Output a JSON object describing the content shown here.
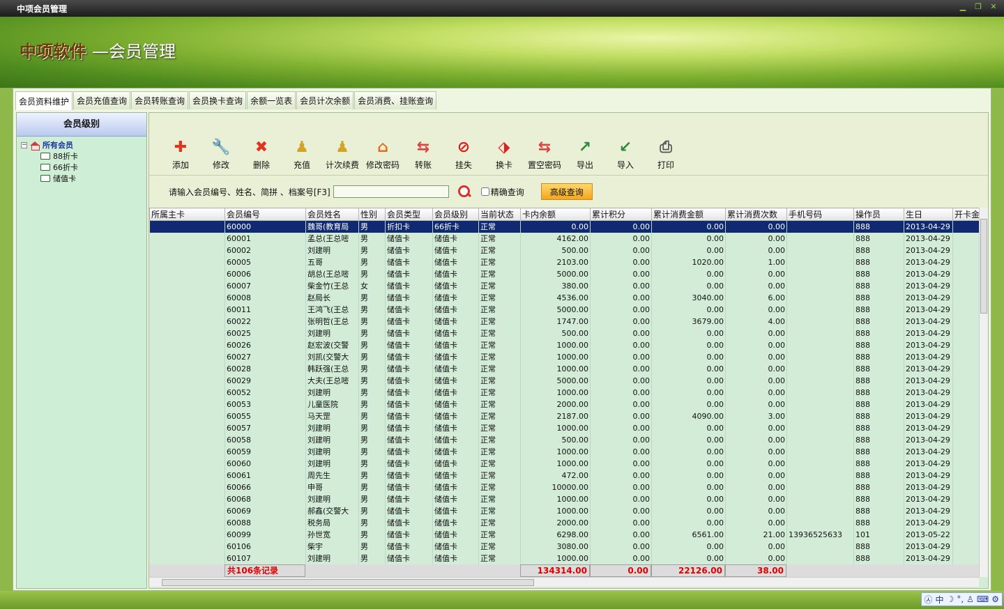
{
  "window": {
    "title": "中项会员管理"
  },
  "banner": {
    "brand": "中项软件",
    "subtitle": "—会员管理"
  },
  "tabs": [
    "会员资料维护",
    "会员充值查询",
    "会员转账查询",
    "会员换卡查询",
    "余额一览表",
    "会员计次余额",
    "会员消费、挂账查询"
  ],
  "left": {
    "title": "会员级别",
    "root": "所有会员",
    "children": [
      "88折卡",
      "66折卡",
      "储值卡"
    ]
  },
  "toolbar": [
    {
      "label": "添加",
      "icon": "plus-icon",
      "color": "#e0341e"
    },
    {
      "label": "修改",
      "icon": "wrench-icon",
      "color": "#c03030"
    },
    {
      "label": "删除",
      "icon": "x-icon",
      "color": "#e0341e"
    },
    {
      "label": "充值",
      "icon": "pawn-icon",
      "color": "#d2a52a"
    },
    {
      "label": "计次续费",
      "icon": "pawn-icon",
      "color": "#d2a52a"
    },
    {
      "label": "修改密码",
      "icon": "house-key-icon",
      "color": "#e07020"
    },
    {
      "label": "转账",
      "icon": "arrows-icon",
      "color": "#e04040"
    },
    {
      "label": "挂失",
      "icon": "stop-icon",
      "color": "#e01818"
    },
    {
      "label": "换卡",
      "icon": "card-swap-icon",
      "color": "#e02020"
    },
    {
      "label": "置空密码",
      "icon": "arrows-icon",
      "color": "#e04040"
    },
    {
      "label": "导出",
      "icon": "excel-export-icon",
      "color": "#2a8a3a"
    },
    {
      "label": "导入",
      "icon": "excel-import-icon",
      "color": "#2a8a3a"
    },
    {
      "label": "打印",
      "icon": "printer-icon",
      "color": "#555555"
    }
  ],
  "search": {
    "label": "请输入会员编号、姓名、简拼 、档案号[F3]",
    "value": "",
    "exact_label": "精确查询",
    "adv_label": "高级查询"
  },
  "columns": [
    "所属主卡",
    "会员编号",
    "会员姓名",
    "性别",
    "会员类型",
    "会员级别",
    "当前状态",
    "卡内余额",
    "累计积分",
    "累计消费金额",
    "累计消费次数",
    "手机号码",
    "操作员",
    "生日",
    "开卡金"
  ],
  "rows": [
    [
      "",
      "60000",
      "魏哥(教育局",
      "男",
      "折扣卡",
      "66折卡",
      "正常",
      "0.00",
      "0.00",
      "0.00",
      "0.00",
      "",
      "888",
      "2013-04-29",
      ""
    ],
    [
      "",
      "60001",
      "孟总(王总嘧",
      "男",
      "储值卡",
      "储值卡",
      "正常",
      "4162.00",
      "0.00",
      "0.00",
      "0.00",
      "",
      "888",
      "2013-04-29",
      ""
    ],
    [
      "",
      "60002",
      "刘建明",
      "男",
      "储值卡",
      "储值卡",
      "正常",
      "500.00",
      "0.00",
      "0.00",
      "0.00",
      "",
      "888",
      "2013-04-29",
      ""
    ],
    [
      "",
      "60005",
      "五哥",
      "男",
      "储值卡",
      "储值卡",
      "正常",
      "2103.00",
      "0.00",
      "1020.00",
      "1.00",
      "",
      "888",
      "2013-04-29",
      ""
    ],
    [
      "",
      "60006",
      "胡总(王总嘧",
      "男",
      "储值卡",
      "储值卡",
      "正常",
      "5000.00",
      "0.00",
      "0.00",
      "0.00",
      "",
      "888",
      "2013-04-29",
      ""
    ],
    [
      "",
      "60007",
      "柴金竹(王总",
      "女",
      "储值卡",
      "储值卡",
      "正常",
      "380.00",
      "0.00",
      "0.00",
      "0.00",
      "",
      "888",
      "2013-04-29",
      ""
    ],
    [
      "",
      "60008",
      "赵局长",
      "男",
      "储值卡",
      "储值卡",
      "正常",
      "4536.00",
      "0.00",
      "3040.00",
      "6.00",
      "",
      "888",
      "2013-04-29",
      ""
    ],
    [
      "",
      "60011",
      "王鸿飞(王总",
      "男",
      "储值卡",
      "储值卡",
      "正常",
      "5000.00",
      "0.00",
      "0.00",
      "0.00",
      "",
      "888",
      "2013-04-29",
      ""
    ],
    [
      "",
      "60022",
      "张明哲(王总",
      "男",
      "储值卡",
      "储值卡",
      "正常",
      "1747.00",
      "0.00",
      "3679.00",
      "4.00",
      "",
      "888",
      "2013-04-29",
      ""
    ],
    [
      "",
      "60025",
      "刘建明",
      "男",
      "储值卡",
      "储值卡",
      "正常",
      "500.00",
      "0.00",
      "0.00",
      "0.00",
      "",
      "888",
      "2013-04-29",
      ""
    ],
    [
      "",
      "60026",
      "赵宏波(交警",
      "男",
      "储值卡",
      "储值卡",
      "正常",
      "1000.00",
      "0.00",
      "0.00",
      "0.00",
      "",
      "888",
      "2013-04-29",
      ""
    ],
    [
      "",
      "60027",
      "刘凯(交警大",
      "男",
      "储值卡",
      "储值卡",
      "正常",
      "1000.00",
      "0.00",
      "0.00",
      "0.00",
      "",
      "888",
      "2013-04-29",
      ""
    ],
    [
      "",
      "60028",
      "韩跃强(王总",
      "男",
      "储值卡",
      "储值卡",
      "正常",
      "1000.00",
      "0.00",
      "0.00",
      "0.00",
      "",
      "888",
      "2013-04-29",
      ""
    ],
    [
      "",
      "60029",
      "大夫(王总嘧",
      "男",
      "储值卡",
      "储值卡",
      "正常",
      "5000.00",
      "0.00",
      "0.00",
      "0.00",
      "",
      "888",
      "2013-04-29",
      ""
    ],
    [
      "",
      "60052",
      "刘建明",
      "男",
      "储值卡",
      "储值卡",
      "正常",
      "1000.00",
      "0.00",
      "0.00",
      "0.00",
      "",
      "888",
      "2013-04-29",
      ""
    ],
    [
      "",
      "60053",
      "儿童医院",
      "男",
      "储值卡",
      "储值卡",
      "正常",
      "2000.00",
      "0.00",
      "0.00",
      "0.00",
      "",
      "888",
      "2013-04-29",
      ""
    ],
    [
      "",
      "60055",
      "马天罡",
      "男",
      "储值卡",
      "储值卡",
      "正常",
      "2187.00",
      "0.00",
      "4090.00",
      "3.00",
      "",
      "888",
      "2013-04-29",
      ""
    ],
    [
      "",
      "60057",
      "刘建明",
      "男",
      "储值卡",
      "储值卡",
      "正常",
      "1000.00",
      "0.00",
      "0.00",
      "0.00",
      "",
      "888",
      "2013-04-29",
      ""
    ],
    [
      "",
      "60058",
      "刘建明",
      "男",
      "储值卡",
      "储值卡",
      "正常",
      "500.00",
      "0.00",
      "0.00",
      "0.00",
      "",
      "888",
      "2013-04-29",
      ""
    ],
    [
      "",
      "60059",
      "刘建明",
      "男",
      "储值卡",
      "储值卡",
      "正常",
      "1000.00",
      "0.00",
      "0.00",
      "0.00",
      "",
      "888",
      "2013-04-29",
      ""
    ],
    [
      "",
      "60060",
      "刘建明",
      "男",
      "储值卡",
      "储值卡",
      "正常",
      "1000.00",
      "0.00",
      "0.00",
      "0.00",
      "",
      "888",
      "2013-04-29",
      ""
    ],
    [
      "",
      "60061",
      "周先生",
      "男",
      "储值卡",
      "储值卡",
      "正常",
      "472.00",
      "0.00",
      "0.00",
      "0.00",
      "",
      "888",
      "2013-04-29",
      ""
    ],
    [
      "",
      "60066",
      "申哥",
      "男",
      "储值卡",
      "储值卡",
      "正常",
      "10000.00",
      "0.00",
      "0.00",
      "0.00",
      "",
      "888",
      "2013-04-29",
      ""
    ],
    [
      "",
      "60068",
      "刘建明",
      "男",
      "储值卡",
      "储值卡",
      "正常",
      "1000.00",
      "0.00",
      "0.00",
      "0.00",
      "",
      "888",
      "2013-04-29",
      ""
    ],
    [
      "",
      "60069",
      "郝鑫(交警大",
      "男",
      "储值卡",
      "储值卡",
      "正常",
      "1000.00",
      "0.00",
      "0.00",
      "0.00",
      "",
      "888",
      "2013-04-29",
      ""
    ],
    [
      "",
      "60088",
      "税务局",
      "男",
      "储值卡",
      "储值卡",
      "正常",
      "2000.00",
      "0.00",
      "0.00",
      "0.00",
      "",
      "888",
      "2013-04-29",
      ""
    ],
    [
      "",
      "60099",
      "孙世宽",
      "男",
      "储值卡",
      "储值卡",
      "正常",
      "6298.00",
      "0.00",
      "6561.00",
      "21.00",
      "13936525633",
      "101",
      "2013-05-22",
      ""
    ],
    [
      "",
      "60106",
      "柴宇",
      "男",
      "储值卡",
      "储值卡",
      "正常",
      "3080.00",
      "0.00",
      "0.00",
      "0.00",
      "",
      "888",
      "2013-04-29",
      ""
    ],
    [
      "",
      "60107",
      "刘建明",
      "男",
      "储值卡",
      "储值卡",
      "正常",
      "1000.00",
      "0.00",
      "0.00",
      "0.00",
      "",
      "888",
      "2013-04-29",
      ""
    ]
  ],
  "summary": {
    "count": "共106条记录",
    "balance": "134314.00",
    "points": "0.00",
    "amount": "22126.00",
    "times": "38.00"
  },
  "ime": {
    "label": "中"
  }
}
